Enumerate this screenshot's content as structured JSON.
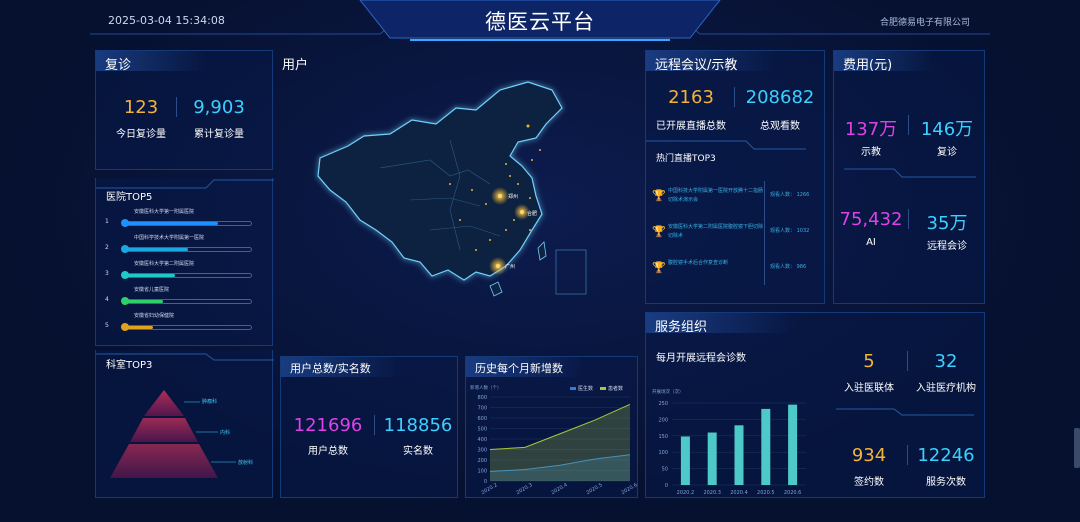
{
  "header": {
    "datetime": "2025-03-04 15:34:08",
    "title": "德医云平台",
    "company": "合肥德易电子有限公司"
  },
  "revisit": {
    "title": "复诊",
    "today_value": "123",
    "today_label": "今日复诊量",
    "total_value": "9,903",
    "total_label": "累计复诊量"
  },
  "hospital_top5": {
    "title": "医院TOP5",
    "items": [
      {
        "rank": "1",
        "name": "安徽医科大学第一附属医院",
        "pct": 0.74,
        "color": "#1e90ff"
      },
      {
        "rank": "2",
        "name": "中国科学技术大学附属第一医院",
        "pct": 0.5,
        "color": "#1ba8e0"
      },
      {
        "rank": "3",
        "name": "安徽医科大学第二附属医院",
        "pct": 0.4,
        "color": "#1ec9c9"
      },
      {
        "rank": "4",
        "name": "安徽省儿童医院",
        "pct": 0.3,
        "color": "#2fd06a"
      },
      {
        "rank": "5",
        "name": "安徽省妇幼保健院",
        "pct": 0.22,
        "color": "#e0a21b"
      }
    ]
  },
  "dept_top3": {
    "title": "科室TOP3",
    "items": [
      "肿瘤科",
      "内科",
      "放射科"
    ]
  },
  "users_map": {
    "title": "用户",
    "cities": [
      "郑州",
      "合肥",
      "广州"
    ]
  },
  "user_totals": {
    "title": "用户总数/实名数",
    "total_value": "121696",
    "total_label": "用户总数",
    "real_value": "118856",
    "real_label": "实名数"
  },
  "history": {
    "title": "历史每个月新增数",
    "unit": "新增人数（个）",
    "legend": [
      "医生数",
      "患者数"
    ]
  },
  "remote_meeting": {
    "title": "远程会议/示教",
    "live_value": "2163",
    "live_label": "已开展直播总数",
    "view_value": "208682",
    "view_label": "总观看数",
    "top3_title": "热门直播TOP3",
    "top3": [
      {
        "name": "中国科技大学附属第一医院开放腾十二指肠切除术演示会",
        "count": "观看人数： 1266"
      },
      {
        "name": "安徽医科大学第二附属医院腹腔镜下胆切除切除术",
        "count": "观看人数： 1032"
      },
      {
        "name": "腹腔镜手术后合作复查诊断",
        "count": "观看人数： 986"
      }
    ]
  },
  "fees": {
    "title": "费用(元)",
    "items": [
      {
        "value": "137万",
        "label": "示教",
        "color": "#e040e8"
      },
      {
        "value": "146万",
        "label": "复诊",
        "color": "#3ad0ff"
      },
      {
        "value": "75,432",
        "label": "AI",
        "color": "#e040e8"
      },
      {
        "value": "35万",
        "label": "远程会诊",
        "color": "#3ad0ff"
      }
    ]
  },
  "service": {
    "title": "服务组织",
    "chart_title": "每月开展远程会诊数",
    "y_unit": "开展场次（次）",
    "items": [
      {
        "value": "5",
        "label": "入驻医联体",
        "color": "#f5b335"
      },
      {
        "value": "32",
        "label": "入驻医疗机构",
        "color": "#3ad0ff"
      },
      {
        "value": "934",
        "label": "签约数",
        "color": "#f5b335"
      },
      {
        "value": "12246",
        "label": "服务次数",
        "color": "#3ad0ff"
      }
    ]
  },
  "chart_data": [
    {
      "type": "area",
      "title": "历史每个月新增数",
      "ylabel": "新增人数（个）",
      "x": [
        "2020.2",
        "2020.3",
        "2020.4",
        "2020.5",
        "2020.6"
      ],
      "ylim": [
        0,
        800
      ],
      "series": [
        {
          "name": "医生数",
          "values": [
            90,
            110,
            150,
            210,
            250
          ]
        },
        {
          "name": "患者数",
          "values": [
            300,
            320,
            450,
            580,
            730
          ]
        }
      ]
    },
    {
      "type": "bar",
      "title": "每月开展远程会诊数",
      "ylabel": "开展场次（次）",
      "categories": [
        "2020.2",
        "2020.3",
        "2020.4",
        "2020.5",
        "2020.6"
      ],
      "values": [
        148,
        160,
        182,
        232,
        245
      ],
      "ylim": [
        0,
        250
      ]
    }
  ],
  "colors": {
    "orange": "#f5b335",
    "cyan": "#3ad0ff",
    "magenta": "#e040e8",
    "panel_border": "#143a7a"
  }
}
